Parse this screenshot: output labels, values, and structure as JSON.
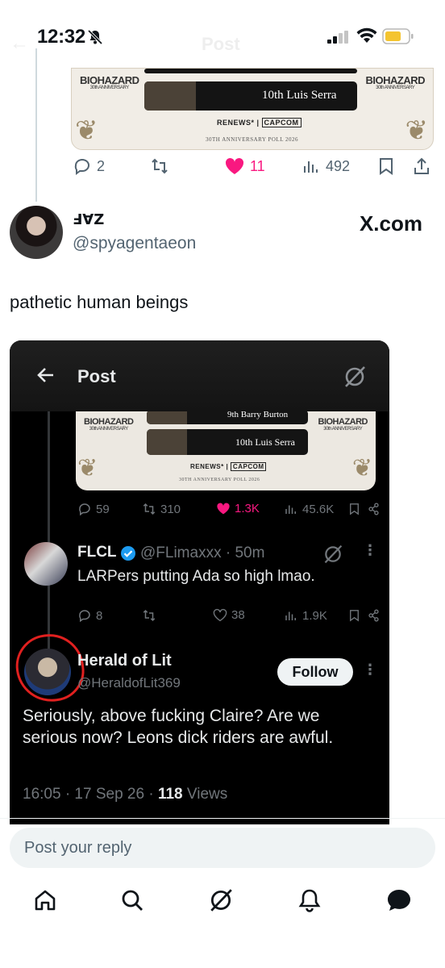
{
  "status": {
    "time": "12:32"
  },
  "ghost_header": {
    "title": "Post"
  },
  "top_card": {
    "logo_left": "BIOHAZARD",
    "logo_left_sub": "30th ANNIVERSARY",
    "logo_right": "BIOHAZARD",
    "logo_right_sub": "30th ANNIVERSARY",
    "entry": "10th Luis Serra",
    "renews": "RENEWS",
    "capcom": "CAPCOM",
    "caption": "30TH ANNIVERSARY POLL 2026"
  },
  "top_actions": {
    "replies": "2",
    "likes": "11",
    "views": "492"
  },
  "tweet": {
    "display_name": "ꓞꓯꓜ",
    "handle": "@spyagentaeon",
    "source": "X.com",
    "text": "pathetic human beings"
  },
  "screenshot": {
    "header_title": "Post",
    "card": {
      "entry_top": "9th Barry Burton",
      "entry": "10th Luis Serra",
      "logo": "BIOHAZARD",
      "logo_sub": "30th ANNIVERSARY",
      "renews": "RENEWS",
      "capcom": "CAPCOM",
      "caption": "30TH ANNIVERSARY POLL 2026"
    },
    "actions": {
      "replies": "59",
      "reposts": "310",
      "likes": "1.3K",
      "views": "45.6K"
    },
    "reply1": {
      "name": "FLCL",
      "handle": "@FLimaxxx · 50m",
      "text": "LARPers putting Ada so high lmao.",
      "actions": {
        "replies": "8",
        "likes": "38",
        "views": "1.9K"
      }
    },
    "reply2": {
      "name": "Herald of Lit",
      "handle": "@HeraldofLit369",
      "follow_label": "Follow",
      "text": "Seriously, above fucking Claire? Are we serious now? Leons dick riders are awful.",
      "time_date": "16:05 · 17 Sep 26 · ",
      "views_count": "118",
      "views_label": " Views"
    }
  },
  "reply_bar": {
    "placeholder": "Post your reply"
  },
  "colors": {
    "like": "#f91880",
    "verified": "#1d9bf0",
    "red_annotation": "#e0201f"
  }
}
